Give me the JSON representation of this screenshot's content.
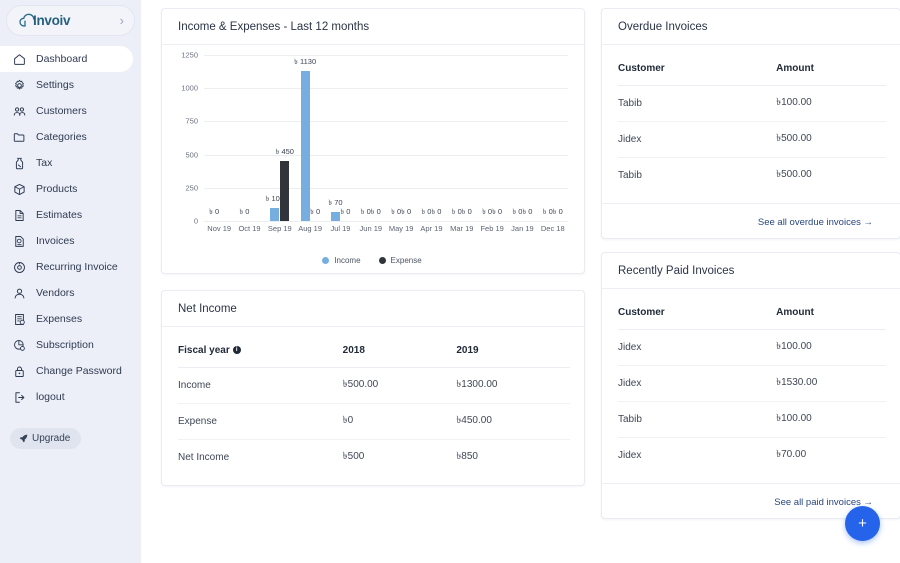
{
  "brand": {
    "name": "Invoiv",
    "chevron": "›"
  },
  "sidebar": {
    "items": [
      {
        "label": "Dashboard",
        "icon": "home-icon",
        "active": true
      },
      {
        "label": "Settings",
        "icon": "gear-icon",
        "active": false
      },
      {
        "label": "Customers",
        "icon": "customers-icon",
        "active": false
      },
      {
        "label": "Categories",
        "icon": "folder-icon",
        "active": false
      },
      {
        "label": "Tax",
        "icon": "tax-icon",
        "active": false
      },
      {
        "label": "Products",
        "icon": "box-icon",
        "active": false
      },
      {
        "label": "Estimates",
        "icon": "document-icon",
        "active": false
      },
      {
        "label": "Invoices",
        "icon": "invoice-icon",
        "active": false
      },
      {
        "label": "Recurring Invoice",
        "icon": "recurring-icon",
        "active": false
      },
      {
        "label": "Vendors",
        "icon": "vendors-icon",
        "active": false
      },
      {
        "label": "Expenses",
        "icon": "expenses-icon",
        "active": false
      },
      {
        "label": "Subscription",
        "icon": "subscription-icon",
        "active": false
      },
      {
        "label": "Change Password",
        "icon": "lock-icon",
        "active": false
      },
      {
        "label": "logout",
        "icon": "logout-icon",
        "active": false
      }
    ],
    "upgrade_label": "Upgrade"
  },
  "chart_card": {
    "title": "Income & Expenses - Last 12 months"
  },
  "chart_data": {
    "type": "bar",
    "title": "Income & Expenses - Last 12 months",
    "xlabel": "",
    "ylabel": "",
    "ylim": [
      0,
      1250
    ],
    "yticks": [
      0,
      250,
      500,
      750,
      1000,
      1250
    ],
    "grid": true,
    "legend_position": "bottom",
    "currency_symbol": "৳",
    "categories": [
      "Nov 19",
      "Oct 19",
      "Sep 19",
      "Aug 19",
      "Jul 19",
      "Jun 19",
      "May 19",
      "Apr 19",
      "Mar 19",
      "Feb 19",
      "Jan 19",
      "Dec 18"
    ],
    "series": [
      {
        "name": "Income",
        "color": "#77aee0",
        "values": [
          0,
          0,
          100,
          1130,
          70,
          0,
          0,
          0,
          0,
          0,
          0,
          0
        ],
        "labels": [
          "৳ 0",
          "৳ 0",
          "৳ 100",
          "৳ 1130",
          "৳ 70",
          "৳ 0",
          "৳ 0",
          "৳ 0",
          "৳ 0",
          "৳ 0",
          "৳ 0",
          "৳ 0"
        ]
      },
      {
        "name": "Expense",
        "color": "#32343c",
        "values": [
          0,
          0,
          450,
          0,
          0,
          0,
          0,
          0,
          0,
          0,
          0,
          0
        ],
        "labels": [
          "",
          "",
          "৳ 450",
          "৳ 0",
          "৳ 0",
          "৳ 0",
          "৳ 0",
          "৳ 0",
          "৳ 0",
          "৳ 0",
          "৳ 0",
          "৳ 0"
        ]
      }
    ]
  },
  "net_income": {
    "title": "Net Income",
    "headers": [
      "Fiscal year",
      "2018",
      "2019"
    ],
    "rows": [
      {
        "label": "Income",
        "y2018": "৳500.00",
        "y2019": "৳1300.00"
      },
      {
        "label": "Expense",
        "y2018": "৳0",
        "y2019": "৳450.00"
      },
      {
        "label": "Net Income",
        "y2018": "৳500",
        "y2019": "৳850"
      }
    ]
  },
  "overdue": {
    "title": "Overdue Invoices",
    "headers": [
      "Customer",
      "Amount"
    ],
    "rows": [
      {
        "customer": "Tabib",
        "amount": "৳100.00"
      },
      {
        "customer": "Jidex",
        "amount": "৳500.00"
      },
      {
        "customer": "Tabib",
        "amount": "৳500.00"
      }
    ],
    "see_all": "See all overdue invoices →"
  },
  "paid": {
    "title": "Recently Paid Invoices",
    "headers": [
      "Customer",
      "Amount"
    ],
    "rows": [
      {
        "customer": "Jidex",
        "amount": "৳100.00"
      },
      {
        "customer": "Jidex",
        "amount": "৳1530.00"
      },
      {
        "customer": "Tabib",
        "amount": "৳100.00"
      },
      {
        "customer": "Jidex",
        "amount": "৳70.00"
      }
    ],
    "see_all": "See all paid invoices →"
  },
  "fab": {
    "label": "+"
  },
  "colors": {
    "accent": "#2563eb",
    "income": "#77aee0",
    "expense": "#32343c",
    "link": "#27477e",
    "sidebar_bg": "#eceff7"
  }
}
